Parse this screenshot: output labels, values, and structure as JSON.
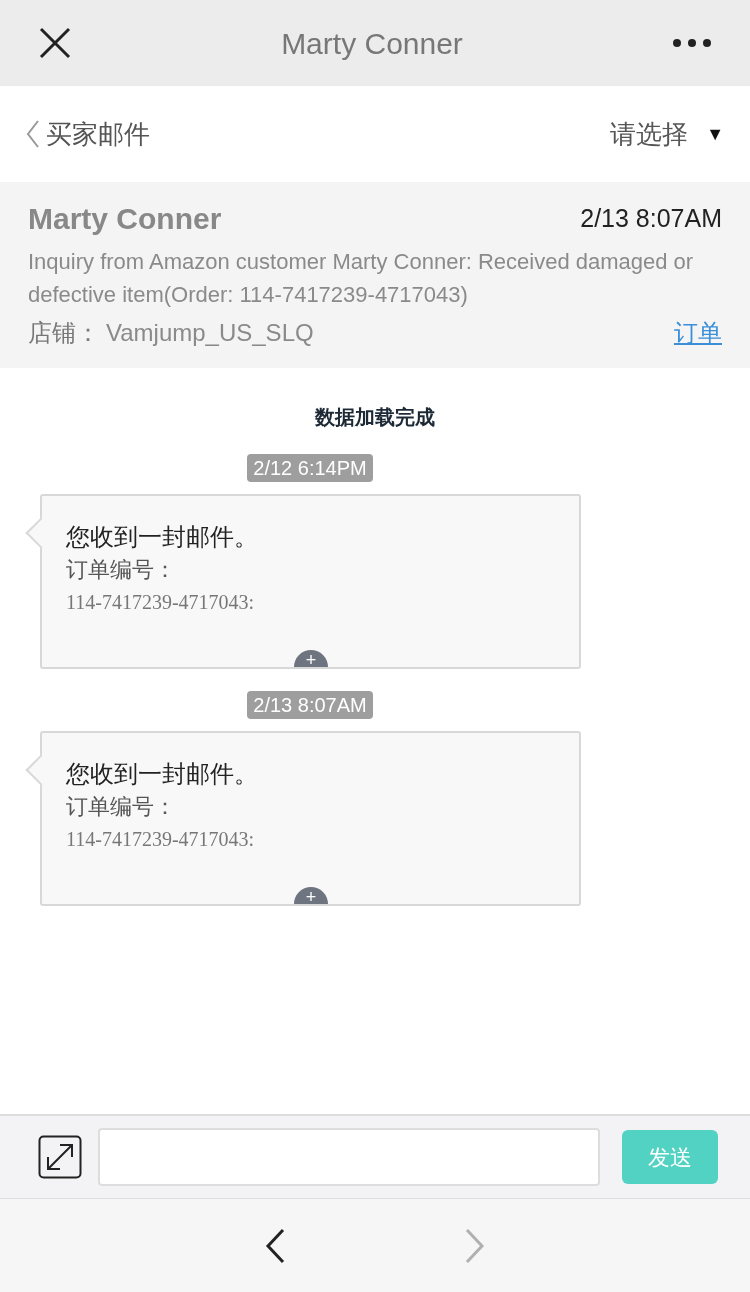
{
  "title_bar": {
    "title": "Marty Conner"
  },
  "sub_header": {
    "back_label": "买家邮件",
    "filter": "请选择",
    "filter_caret": "▼"
  },
  "summary": {
    "name": "Marty Conner",
    "time": "2/13 8:07AM",
    "subject": "Inquiry from Amazon customer Marty Conner: Received damaged or defective item(Order: 114-7417239-4717043)",
    "store_label": "店铺：",
    "store": "Vamjump_US_SLQ",
    "order_link": "订单"
  },
  "status": "数据加载完成",
  "messages": [
    {
      "time": "2/12 6:14PM",
      "lines": [
        "您收到一封邮件。",
        "订单编号：",
        "114-7417239-4717043:"
      ],
      "more": "+"
    },
    {
      "time": "2/13 8:07AM",
      "lines": [
        "您收到一封邮件。",
        "订单编号：",
        "114-7417239-4717043:"
      ],
      "more": "+"
    }
  ],
  "composer": {
    "send": "发送"
  },
  "nav": {
    "back_disabled": false,
    "forward_disabled": true
  }
}
